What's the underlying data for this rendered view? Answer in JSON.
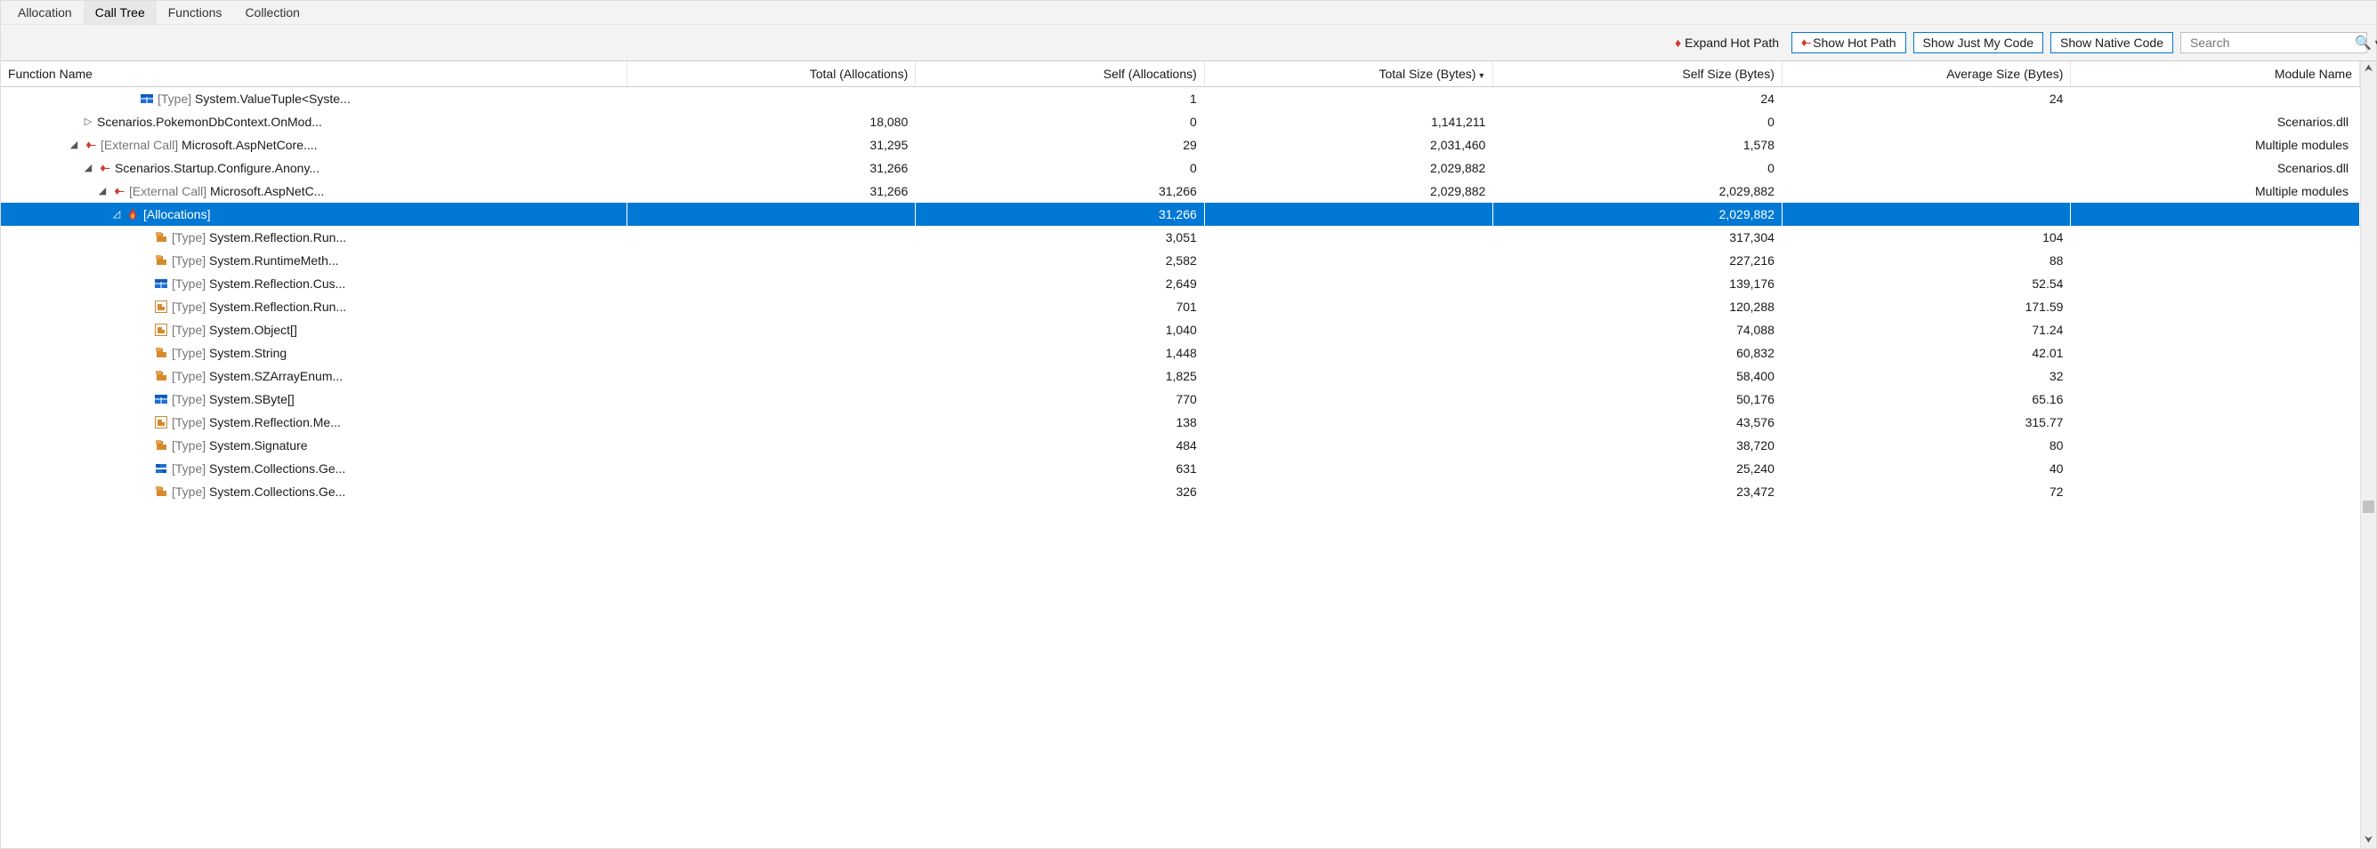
{
  "tabs": [
    {
      "label": "Allocation"
    },
    {
      "label": "Call Tree"
    },
    {
      "label": "Functions"
    },
    {
      "label": "Collection"
    }
  ],
  "active_tab_index": 1,
  "toolbar": {
    "expand_hot_path": "Expand Hot Path",
    "show_hot_path": "Show Hot Path",
    "show_just_my_code": "Show Just My Code",
    "show_native_code": "Show Native Code",
    "search_placeholder": "Search"
  },
  "columns": {
    "function_name": "Function Name",
    "total_alloc": "Total (Allocations)",
    "self_alloc": "Self (Allocations)",
    "total_size": "Total Size (Bytes)",
    "self_size": "Self Size (Bytes)",
    "avg_size": "Average Size (Bytes)",
    "module_name": "Module Name"
  },
  "rows": [
    {
      "indent": 8,
      "expander": "",
      "icon": "struct",
      "prefix": "[Type]",
      "name": "System.ValueTuple<Syste...",
      "total_alloc": "",
      "self_alloc": "1",
      "total_size": "",
      "self_size": "24",
      "avg_size": "24",
      "module": ""
    },
    {
      "indent": 5,
      "expander": "▷",
      "icon": "",
      "prefix": "",
      "name": "Scenarios.PokemonDbContext.OnMod...",
      "total_alloc": "18,080",
      "self_alloc": "0",
      "total_size": "1,141,211",
      "self_size": "0",
      "avg_size": "",
      "module": "Scenarios.dll"
    },
    {
      "indent": 4,
      "expander": "◢",
      "icon": "hotpath",
      "prefix": "[External Call]",
      "name": "Microsoft.AspNetCore....",
      "total_alloc": "31,295",
      "self_alloc": "29",
      "total_size": "2,031,460",
      "self_size": "1,578",
      "avg_size": "",
      "module": "Multiple modules"
    },
    {
      "indent": 5,
      "expander": "◢",
      "icon": "hotpath",
      "prefix": "",
      "name": "Scenarios.Startup.Configure.Anony...",
      "total_alloc": "31,266",
      "self_alloc": "0",
      "total_size": "2,029,882",
      "self_size": "0",
      "avg_size": "",
      "module": "Scenarios.dll"
    },
    {
      "indent": 6,
      "expander": "◢",
      "icon": "hotpath",
      "prefix": "[External Call]",
      "name": "Microsoft.AspNetC...",
      "total_alloc": "31,266",
      "self_alloc": "31,266",
      "total_size": "2,029,882",
      "self_size": "2,029,882",
      "avg_size": "",
      "module": "Multiple modules"
    },
    {
      "indent": 7,
      "expander": "◿",
      "icon": "flame",
      "prefix": "",
      "name": "[Allocations]",
      "total_alloc": "",
      "self_alloc": "31,266",
      "total_size": "",
      "self_size": "2,029,882",
      "avg_size": "",
      "module": "",
      "selected": true
    },
    {
      "indent": 9,
      "expander": "",
      "icon": "class",
      "prefix": "[Type]",
      "name": "System.Reflection.Run...",
      "total_alloc": "",
      "self_alloc": "3,051",
      "total_size": "",
      "self_size": "317,304",
      "avg_size": "104",
      "module": ""
    },
    {
      "indent": 9,
      "expander": "",
      "icon": "class",
      "prefix": "[Type]",
      "name": "System.RuntimeMeth...",
      "total_alloc": "",
      "self_alloc": "2,582",
      "total_size": "",
      "self_size": "227,216",
      "avg_size": "88",
      "module": ""
    },
    {
      "indent": 9,
      "expander": "",
      "icon": "struct",
      "prefix": "[Type]",
      "name": "System.Reflection.Cus...",
      "total_alloc": "",
      "self_alloc": "2,649",
      "total_size": "",
      "self_size": "139,176",
      "avg_size": "52.54",
      "module": ""
    },
    {
      "indent": 9,
      "expander": "",
      "icon": "boxed",
      "prefix": "[Type]",
      "name": "System.Reflection.Run...",
      "total_alloc": "",
      "self_alloc": "701",
      "total_size": "",
      "self_size": "120,288",
      "avg_size": "171.59",
      "module": ""
    },
    {
      "indent": 9,
      "expander": "",
      "icon": "boxed",
      "prefix": "[Type]",
      "name": "System.Object[]",
      "total_alloc": "",
      "self_alloc": "1,040",
      "total_size": "",
      "self_size": "74,088",
      "avg_size": "71.24",
      "module": ""
    },
    {
      "indent": 9,
      "expander": "",
      "icon": "class",
      "prefix": "[Type]",
      "name": "System.String",
      "total_alloc": "",
      "self_alloc": "1,448",
      "total_size": "",
      "self_size": "60,832",
      "avg_size": "42.01",
      "module": ""
    },
    {
      "indent": 9,
      "expander": "",
      "icon": "class",
      "prefix": "[Type]",
      "name": "System.SZArrayEnum...",
      "total_alloc": "",
      "self_alloc": "1,825",
      "total_size": "",
      "self_size": "58,400",
      "avg_size": "32",
      "module": ""
    },
    {
      "indent": 9,
      "expander": "",
      "icon": "struct",
      "prefix": "[Type]",
      "name": "System.SByte[]",
      "total_alloc": "",
      "self_alloc": "770",
      "total_size": "",
      "self_size": "50,176",
      "avg_size": "65.16",
      "module": ""
    },
    {
      "indent": 9,
      "expander": "",
      "icon": "boxed",
      "prefix": "[Type]",
      "name": "System.Reflection.Me...",
      "total_alloc": "",
      "self_alloc": "138",
      "total_size": "",
      "self_size": "43,576",
      "avg_size": "315.77",
      "module": ""
    },
    {
      "indent": 9,
      "expander": "",
      "icon": "class",
      "prefix": "[Type]",
      "name": "System.Signature",
      "total_alloc": "",
      "self_alloc": "484",
      "total_size": "",
      "self_size": "38,720",
      "avg_size": "80",
      "module": ""
    },
    {
      "indent": 9,
      "expander": "",
      "icon": "interface",
      "prefix": "[Type]",
      "name": "System.Collections.Ge...",
      "total_alloc": "",
      "self_alloc": "631",
      "total_size": "",
      "self_size": "25,240",
      "avg_size": "40",
      "module": ""
    },
    {
      "indent": 9,
      "expander": "",
      "icon": "class",
      "prefix": "[Type]",
      "name": "System.Collections.Ge...",
      "total_alloc": "",
      "self_alloc": "326",
      "total_size": "",
      "self_size": "23,472",
      "avg_size": "72",
      "module": ""
    }
  ]
}
